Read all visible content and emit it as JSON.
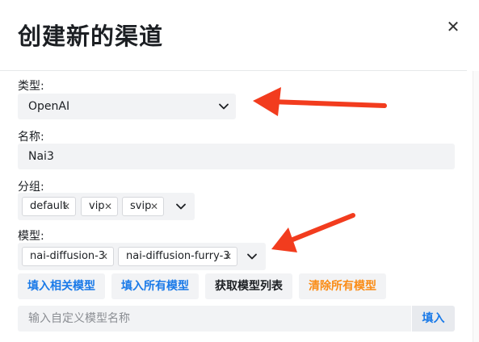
{
  "dialog": {
    "title": "创建新的渠道",
    "close_glyph": "✕"
  },
  "type_field": {
    "label": "类型:",
    "value": "OpenAI"
  },
  "name_field": {
    "label": "名称:",
    "value": "Nai3"
  },
  "group_field": {
    "label": "分组:",
    "tags": [
      "default",
      "vip",
      "svip"
    ],
    "remove_glyph": "✕"
  },
  "model_field": {
    "label": "模型:",
    "tags": [
      "nai-diffusion-3",
      "nai-diffusion-furry-3"
    ],
    "remove_glyph": "✕"
  },
  "actions": {
    "fill_related": "填入相关模型",
    "fill_all": "填入所有模型",
    "fetch_list": "获取模型列表",
    "clear_all": "清除所有模型"
  },
  "custom_model": {
    "placeholder": "输入自定义模型名称",
    "fill_button": "填入"
  },
  "colors": {
    "accent_blue": "#1a7ae8",
    "danger_orange": "#fa8c16",
    "annotation_red": "#f23c1e",
    "field_bg": "#f2f3f5"
  },
  "icons": {
    "close": "close-icon",
    "dropdown": "chevron-down-icon",
    "tag_remove": "close-icon",
    "annotation": "red-arrow-icon"
  }
}
